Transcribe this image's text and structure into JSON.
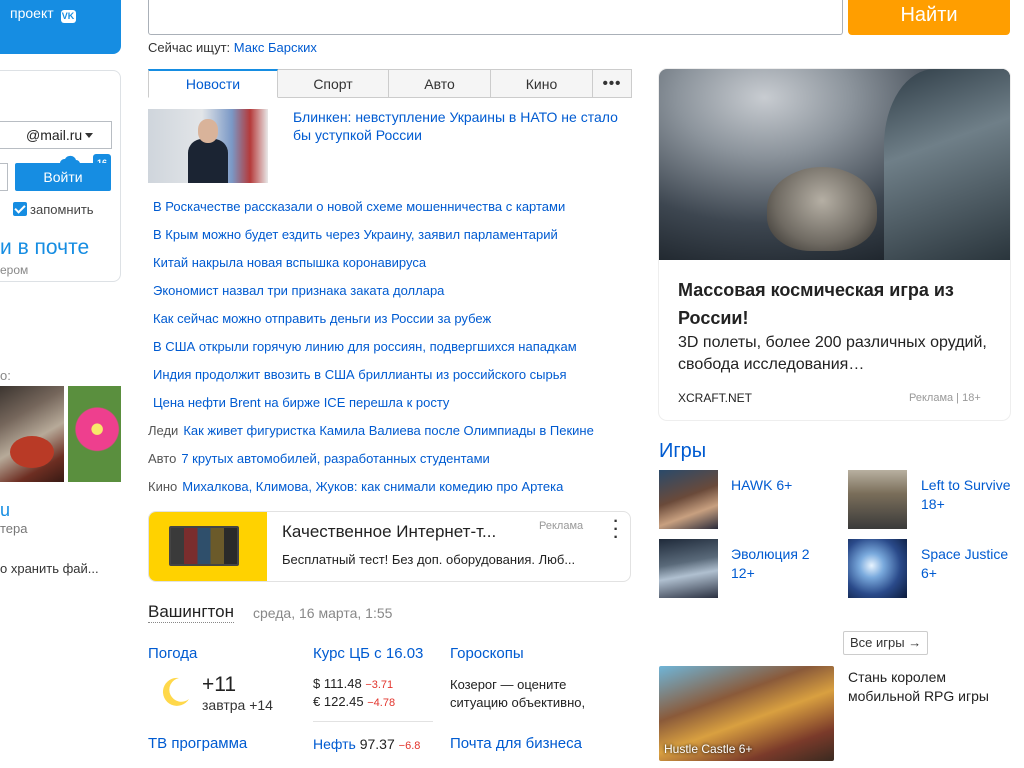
{
  "promo": {
    "text": "проект",
    "vk": "VK"
  },
  "login": {
    "domain": "@mail.ru",
    "enter_button": "Войти",
    "remember": "запомнить",
    "in_mail": "и в почте",
    "in_mail_sub": "ером",
    "calendar_day": "16"
  },
  "left": {
    "photos_label": "о:",
    "cloud_title": "u",
    "cloud_sub": "тера",
    "cloud_text": "о хранить фай..."
  },
  "search": {
    "placeholder": "",
    "button": "Найти",
    "suggest_label": "Сейчас ищут:",
    "suggest_link": "Макс Барских"
  },
  "tabs": [
    {
      "label": "Новости"
    },
    {
      "label": "Спорт"
    },
    {
      "label": "Авто"
    },
    {
      "label": "Кино"
    },
    {
      "label": "•••"
    }
  ],
  "top_news": {
    "headline": "Блинкен: невступление Украины в НАТО не стало бы уступкой России"
  },
  "news": [
    {
      "category": "",
      "text": "В Роскачестве рассказали о новой схеме мошенничества с картами"
    },
    {
      "category": "",
      "text": "В Крым можно будет ездить через Украину, заявил парламентарий"
    },
    {
      "category": "",
      "text": "Китай накрыла новая вспышка коронавируса"
    },
    {
      "category": "",
      "text": "Экономист назвал три признака заката доллара"
    },
    {
      "category": "",
      "text": "Как сейчас можно отправить деньги из России за рубеж"
    },
    {
      "category": "",
      "text": "В США открыли горячую линию для россиян, подвергшихся нападкам"
    },
    {
      "category": "",
      "text": "Индия продолжит ввозить в США бриллианты из российского сырья"
    },
    {
      "category": "",
      "text": "Цена нефти Brent на бирже ICE перешла к росту"
    },
    {
      "category": "Леди",
      "text": "Как живет фигуристка Камила Валиева после Олимпиады в Пекине"
    },
    {
      "category": "Авто",
      "text": "7 крутых автомобилей, разработанных студентами"
    },
    {
      "category": "Кино",
      "text": "Михалкова, Климова, Жуков: как снимали комедию про Артека"
    }
  ],
  "ad_card": {
    "title": "Качественное Интернет-т...",
    "label": "Реклама",
    "text": "Бесплатный тест! Без доп. оборудования. Люб..."
  },
  "city": {
    "name": "Вашингтон",
    "date": "среда, 16 марта, 1:55"
  },
  "weather": {
    "label": "Погода",
    "temp": "+11",
    "tomorrow": "завтра +14"
  },
  "tv": {
    "label": "ТВ программа"
  },
  "currency": {
    "label": "Курс ЦБ с 16.03",
    "usd_sign": "$",
    "usd": "111.48",
    "usd_change": "−3.71",
    "eur_sign": "€",
    "eur": "122.45",
    "eur_change": "−4.78",
    "oil_label": "Нефть",
    "oil": "97.37",
    "oil_change": "−6.8"
  },
  "horoscope": {
    "label": "Гороскопы",
    "text": "Козерог — оцените ситуацию объективно,"
  },
  "business": {
    "label": "Почта для бизнеса"
  },
  "big_ad": {
    "title": "Массовая космическая игра из России!",
    "desc": "3D полеты, более 200 различных орудий, свобода исследования…",
    "site": "XCRAFT.NET",
    "label": "Реклама | 18+"
  },
  "games": {
    "heading": "Игры",
    "items": [
      {
        "name": "HAWK 6+"
      },
      {
        "name": "Left to Survive 18+"
      },
      {
        "name": "Эволюция 2 12+"
      },
      {
        "name": "Space Justice 6+"
      }
    ],
    "all_button": "Все игры →",
    "promo_name": "Hustle Castle 6+",
    "promo_text": "Стань королем мобильной RPG игры"
  },
  "colors": {
    "accent": "#168de2",
    "link": "#005bd1",
    "search_button": "#ff9e00",
    "negative": "#e2342c"
  }
}
